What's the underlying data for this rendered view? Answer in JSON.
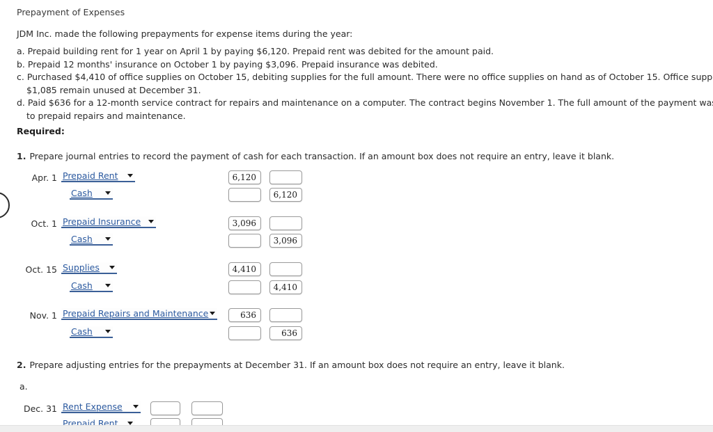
{
  "page": {
    "title": "Prepayment of Expenses",
    "intro": "JDM Inc. made the following prepayments for expense items during the year:",
    "facts": [
      {
        "line1": "a. Prepaid building rent for 1 year on April 1 by paying $6,120. Prepaid rent was debited for the amount paid.",
        "line2": ""
      },
      {
        "line1": "b. Prepaid 12 months' insurance on October 1 by paying $3,096. Prepaid insurance was debited.",
        "line2": ""
      },
      {
        "line1": "c. Purchased $4,410 of office supplies on October 15, debiting supplies for the full amount. There were no office supplies on hand as of October 15. Office supplies costing",
        "line2": "$1,085 remain unused at December 31."
      },
      {
        "line1": "d. Paid $636 for a 12-month service contract for repairs and maintenance on a computer. The contract begins November 1. The full amount of the payment was debited",
        "line2": "to prepaid repairs and maintenance."
      }
    ],
    "required_label": "Required:"
  },
  "question1": {
    "number": "1.",
    "text": "Prepare journal entries to record the payment of cash for each transaction. If an amount box does not require an entry, leave it blank.",
    "rows": [
      {
        "date": "Apr. 1",
        "account": "Prepaid Rent",
        "debit": "6,120",
        "credit": ""
      },
      {
        "date": "",
        "account": "Cash",
        "debit": "",
        "credit": "6,120"
      },
      {
        "date": "Oct. 1",
        "account": "Prepaid Insurance",
        "debit": "3,096",
        "credit": ""
      },
      {
        "date": "",
        "account": "Cash",
        "debit": "",
        "credit": "3,096"
      },
      {
        "date": "Oct. 15",
        "account": "Supplies",
        "debit": "4,410",
        "credit": ""
      },
      {
        "date": "",
        "account": "Cash",
        "debit": "",
        "credit": "4,410"
      },
      {
        "date": "Nov. 1",
        "account": "Prepaid Repairs and Maintenance",
        "debit": "636",
        "credit": ""
      },
      {
        "date": "",
        "account": "Cash",
        "debit": "",
        "credit": "636"
      }
    ]
  },
  "question2": {
    "number": "2.",
    "text": "Prepare adjusting entries for the prepayments at December 31. If an amount box does not require an entry, leave it blank.",
    "sub_label": "a.",
    "rows": [
      {
        "date": "Dec. 31",
        "account": "Rent Expense",
        "debit": "",
        "credit": ""
      },
      {
        "date": "",
        "account": "Prepaid Rent",
        "debit": "",
        "credit": ""
      }
    ]
  },
  "icons": {
    "dropdown_arrow": "chevron-down-icon",
    "edge_widget": "circle-widget-icon"
  },
  "colors": {
    "link_blue": "#2c5aa0",
    "underline_blue": "#3a5f97",
    "box_border": "#9a9a9a",
    "text": "#2b2b2b"
  }
}
